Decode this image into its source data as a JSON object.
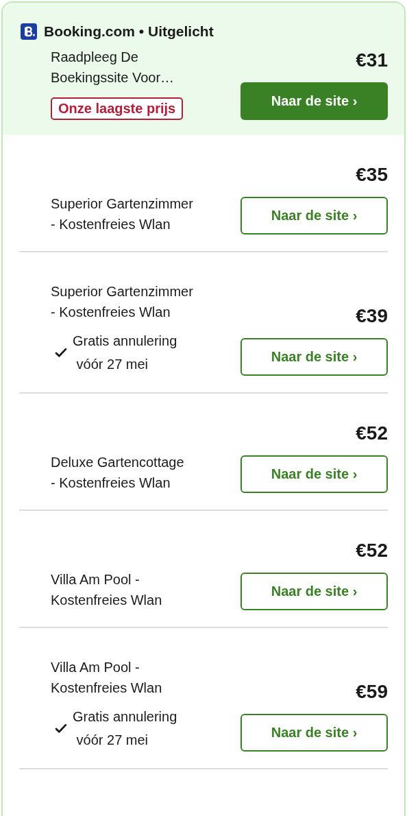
{
  "featured": {
    "provider": "Booking.com • Uitgelicht"
  },
  "offers": [
    {
      "kind": "featured",
      "name": "Raadpleeg De\nBoekingssite Voor…",
      "badge": "Onze laagste prijs",
      "price": "€31",
      "button": "Naar de site ›"
    },
    {
      "kind": "standard",
      "name": "Superior Gartenzimmer\n- Kostenfreies Wlan",
      "price": "€35",
      "button": "Naar de site ›"
    },
    {
      "kind": "standard",
      "name": "Superior Gartenzimmer\n- Kostenfreies Wlan",
      "cancellation": "Gratis annulering\n vóór 27 mei",
      "price": "€39",
      "button": "Naar de site ›"
    },
    {
      "kind": "standard",
      "name": "Deluxe Gartencottage\n- Kostenfreies Wlan",
      "price": "€52",
      "button": "Naar de site ›"
    },
    {
      "kind": "standard",
      "name": "Villa Am Pool -\nKostenfreies Wlan",
      "price": "€52",
      "button": "Naar de site ›"
    },
    {
      "kind": "standard",
      "name": "Villa Am Pool -\nKostenfreies Wlan",
      "cancellation": "Gratis annulering\n vóór 27 mei",
      "price": "€59",
      "button": "Naar de site ›"
    }
  ]
}
